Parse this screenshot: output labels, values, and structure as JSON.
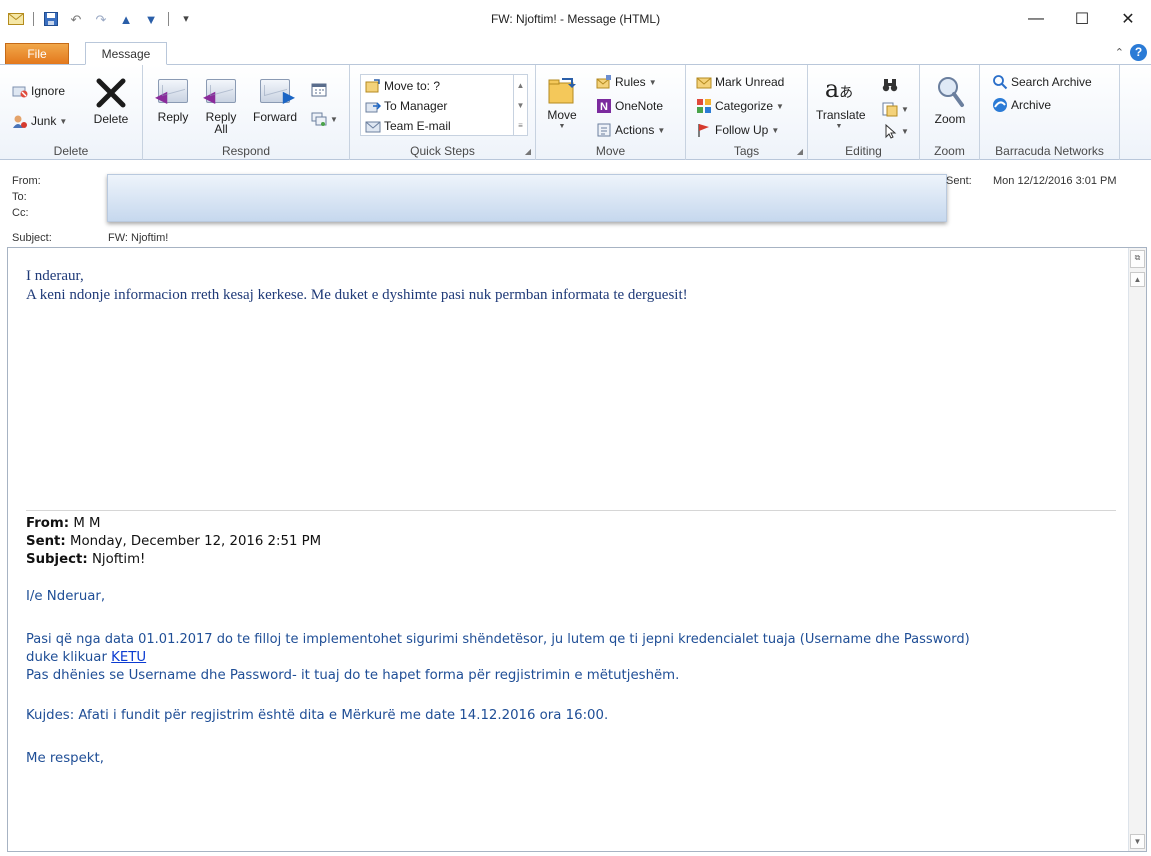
{
  "window": {
    "title": "FW: Njoftim! - Message (HTML)",
    "minimize_glyph": "—",
    "maximize_glyph": "☐",
    "close_glyph": "✕"
  },
  "qat": {
    "icons": [
      "mail-icon",
      "save-icon",
      "undo-icon",
      "redo-icon",
      "up-icon",
      "down-icon",
      "customize-icon"
    ]
  },
  "tabs": {
    "file": "File",
    "message": "Message"
  },
  "ribbon": {
    "delete_group": {
      "ignore": "Ignore",
      "junk": "Junk",
      "delete": "Delete",
      "label": "Delete"
    },
    "respond_group": {
      "reply": "Reply",
      "reply_all_line1": "Reply",
      "reply_all_line2": "All",
      "forward": "Forward",
      "label": "Respond"
    },
    "quick_steps": {
      "items": [
        "Move to: ?",
        "To Manager",
        "Team E-mail"
      ],
      "label": "Quick Steps"
    },
    "move_group": {
      "move": "Move",
      "rules": "Rules",
      "onenote": "OneNote",
      "actions": "Actions",
      "label": "Move"
    },
    "tags_group": {
      "mark_unread": "Mark Unread",
      "categorize": "Categorize",
      "follow_up": "Follow Up",
      "label": "Tags"
    },
    "editing_group": {
      "translate": "Translate",
      "label": "Editing"
    },
    "zoom_group": {
      "zoom": "Zoom",
      "label": "Zoom"
    },
    "barracuda_group": {
      "search_archive": "Search Archive",
      "archive": "Archive",
      "label": "Barracuda Networks"
    }
  },
  "header": {
    "from_label": "From:",
    "to_label": "To:",
    "cc_label": "Cc:",
    "subject_label": "Subject:",
    "subject_value": "FW: Njoftim!",
    "sent_label": "Sent:",
    "sent_value": "Mon 12/12/2016 3:01 PM"
  },
  "body": {
    "greeting": "I nderaur,",
    "message": "A keni ndonje informacion rreth kesaj kerkese. Me duket e dyshimte pasi nuk permban informata te derguesit!",
    "original": {
      "from_label": "From:",
      "from_value": "M M",
      "sent_label": "Sent:",
      "sent_value": "Monday, December 12, 2016 2:51 PM",
      "subject_label": "Subject:",
      "subject_value": "Njoftim!",
      "salutation": "I/e Nderuar,",
      "para1": "Pasi që nga data 01.01.2017 do te filloj te implementohet sigurimi shëndetësor, ju lutem qe ti jepni kredencialet tuaja (Username dhe Password)",
      "para1_line2_prefix": "duke klikuar",
      "link_text": "KETU",
      "para2": "Pas dhënies se Username dhe Password- it tuaj do te hapet forma për regjistrimin e mëtutjeshëm.",
      "para3": "Kujdes: Afati i fundit për regjistrim është dita e Mërkurë me date 14.12.2016 ora 16:00.",
      "closing": "Me respekt,"
    }
  }
}
